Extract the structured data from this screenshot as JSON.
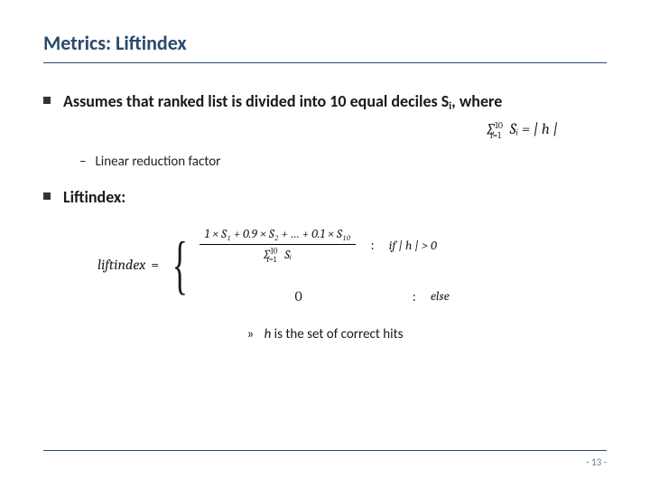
{
  "title": "Metrics: Liftindex",
  "bullet1_prefix": "Assumes that ranked list is divided into 10 equal deciles S",
  "bullet1_sub": "i",
  "bullet1_suffix": ", where",
  "sum_formula": "∑",
  "sum_upper": "10",
  "sum_lower": "i=1",
  "sum_body": "Sᵢ = | h |",
  "sub_bullet": "Linear reduction factor",
  "bullet2": "Liftindex:",
  "lift_label": "liftindex",
  "equals": "=",
  "case1_num": "1 × S₁ + 0.9 × S₂ + … + 0.1 × S₁₀",
  "case1_den_pre": "∑",
  "case1_den_upper": "10",
  "case1_den_lower": "i=1",
  "case1_den_body": "Sᵢ",
  "case1_cond": "if  | h | > 0",
  "case2_val": "0",
  "case2_cond": "else",
  "note_arrow": "»",
  "note_var": "h",
  "note_text": " is the set of correct hits",
  "page": "- 13 -"
}
